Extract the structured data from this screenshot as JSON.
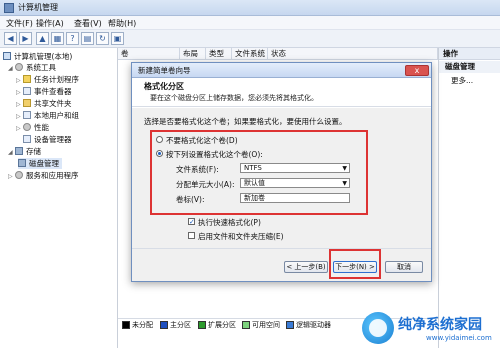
{
  "window": {
    "title": "计算机管理"
  },
  "menu": [
    "文件(F)",
    "操作(A)",
    "查看(V)",
    "帮助(H)"
  ],
  "tree": {
    "root": "计算机管理(本地)",
    "system_tools": "系统工具",
    "items": [
      "任务计划程序",
      "事件查看器",
      "共享文件夹",
      "本地用户和组",
      "性能",
      "设备管理器"
    ],
    "storage": "存储",
    "disk_mgmt": "磁盘管理",
    "services": "服务和应用程序"
  },
  "columns": [
    "卷",
    "布局",
    "类型",
    "文件系统",
    "状态"
  ],
  "actions": {
    "header": "操作",
    "item1": "磁盘管理",
    "item2": "更多..."
  },
  "dialog": {
    "title": "新建简单卷向导",
    "close": "x",
    "heading": "格式化分区",
    "subheading": "要在这个磁盘分区上储存数据，您必须先将其格式化。",
    "prompt": "选择是否要格式化这个卷；如果要格式化，要使用什么设置。",
    "opt_no_format": "不要格式化这个卷(D)",
    "opt_format": "按下列设置格式化这个卷(O):",
    "fs_label": "文件系统(F):",
    "fs_value": "NTFS",
    "alloc_label": "分配单元大小(A):",
    "alloc_value": "默认值",
    "volume_label": "卷标(V):",
    "volume_value": "新加卷",
    "quick_format": "执行快速格式化(P)",
    "compression": "启用文件和文件夹压缩(E)",
    "btn_back": "< 上一步(B)",
    "btn_next": "下一步(N) >",
    "btn_cancel": "取消"
  },
  "legend": [
    {
      "label": "未分配",
      "color": "#000000"
    },
    {
      "label": "主分区",
      "color": "#1f4fbf"
    },
    {
      "label": "扩展分区",
      "color": "#2c9a2c"
    },
    {
      "label": "可用空间",
      "color": "#7ed37e"
    },
    {
      "label": "逻辑驱动器",
      "color": "#3a7bd5"
    }
  ],
  "watermark": {
    "brand": "纯净系统家园",
    "url": "www.yidaimei.com"
  }
}
